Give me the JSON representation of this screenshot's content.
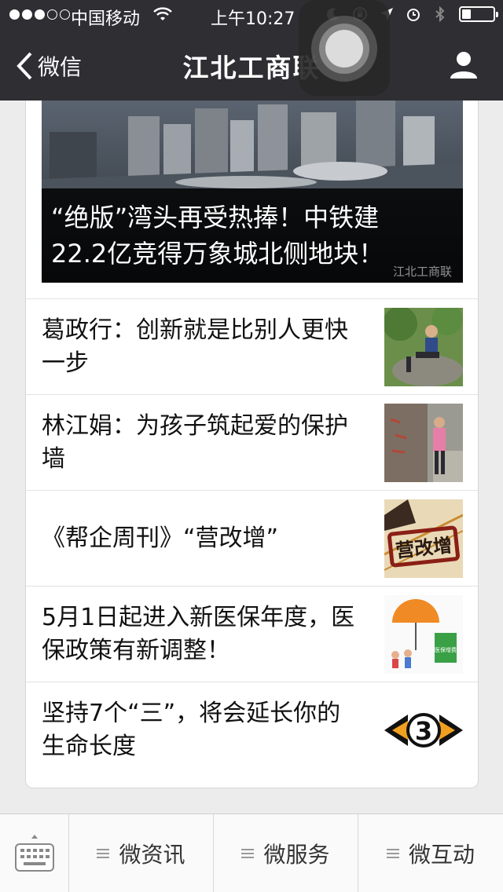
{
  "status_bar": {
    "carrier": "中国移动",
    "time": "上午10:27",
    "battery_level": 0.3
  },
  "nav": {
    "back_label": "微信",
    "title": "江北工商联"
  },
  "hero": {
    "caption_line1": "“绝版”湾头再受热捧！中铁建",
    "caption_line2": "22.2亿竞得万象城北侧地块！",
    "watermark": "江北工商联"
  },
  "articles": [
    {
      "title": "葛政行：创新就是比别人更快一步",
      "thumb": "person-on-rock"
    },
    {
      "title": "林江娟：为孩子筑起爱的保护墙",
      "thumb": "person-by-stone"
    },
    {
      "title": "《帮企周刊》“营改增”",
      "thumb": "tax-stamp"
    },
    {
      "title": "5月1日起进入新医保年度，医保政策有新调整！",
      "thumb": "insurance-umbrella",
      "thumb_text": "医保增费"
    },
    {
      "title": "坚持7个“三”，将会延长你的生命长度",
      "thumb": "number-three",
      "thumb_text": "3"
    }
  ],
  "thumb_overlay_text": {
    "tax": "营改增"
  },
  "menu": {
    "items": [
      {
        "label": "微资讯"
      },
      {
        "label": "微服务"
      },
      {
        "label": "微互动"
      }
    ]
  },
  "colors": {
    "nav_bg": "#2e2e33",
    "page_bg": "#ececec",
    "hero_caption_bg": "#000000"
  }
}
